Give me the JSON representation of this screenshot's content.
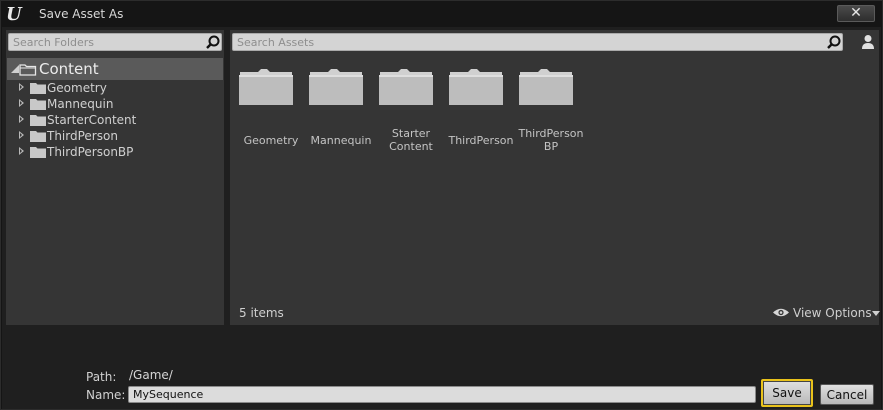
{
  "window": {
    "title": "Save Asset As",
    "close_label": "✕"
  },
  "folders": {
    "search_placeholder": "Search Folders",
    "root": {
      "label": "Content",
      "expanded": true
    },
    "items": [
      {
        "label": "Geometry"
      },
      {
        "label": "Mannequin"
      },
      {
        "label": "StarterContent"
      },
      {
        "label": "ThirdPerson"
      },
      {
        "label": "ThirdPersonBP"
      }
    ]
  },
  "assets": {
    "search_placeholder": "Search Assets",
    "items": [
      {
        "label": "Geometry"
      },
      {
        "label": "Mannequin"
      },
      {
        "label": "Starter Content"
      },
      {
        "label": "ThirdPerson"
      },
      {
        "label": "ThirdPerson BP"
      }
    ],
    "count_label": "5 items",
    "view_options_label": "View Options"
  },
  "footer": {
    "path_label": "Path:",
    "path_value": "/Game/",
    "name_label": "Name:",
    "name_value": "MySequence",
    "save_label": "Save",
    "cancel_label": "Cancel"
  },
  "colors": {
    "highlight": "#e9c21b",
    "panel_bg": "#353535",
    "selected_row": "#5a5a5a"
  },
  "icons": {
    "logo": "unreal-engine-logo",
    "search": "magnifier-icon",
    "folder": "folder-icon",
    "user": "user-icon",
    "eye": "eye-icon"
  }
}
